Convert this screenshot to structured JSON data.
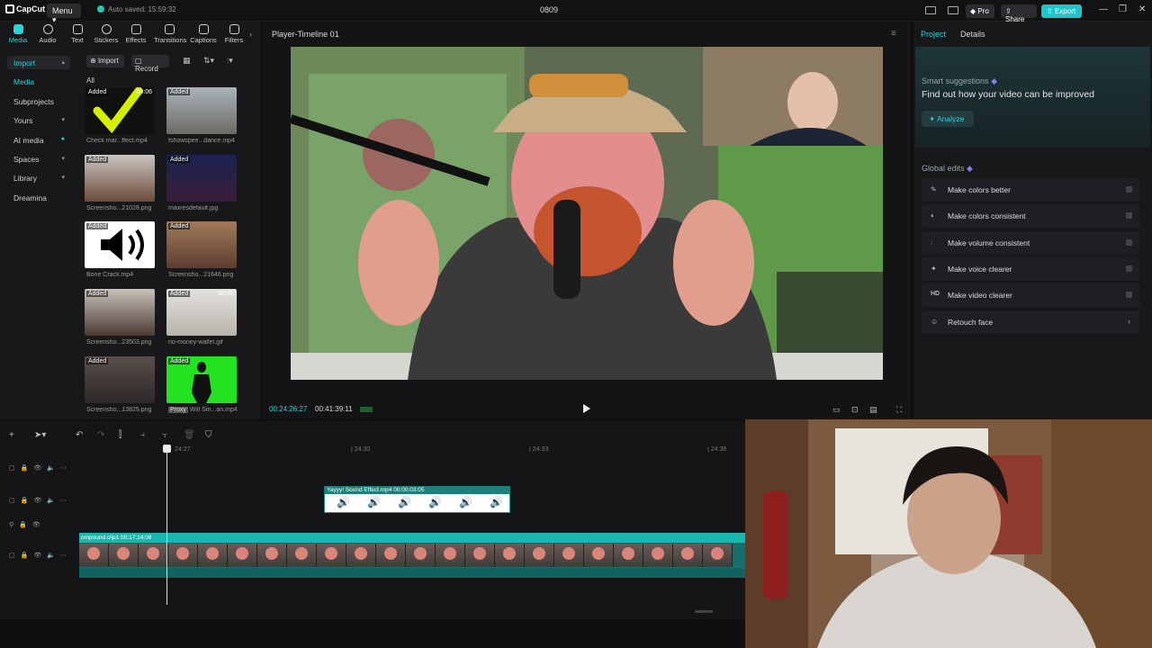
{
  "titlebar": {
    "app_name": "CapCut",
    "menu_label": "Menu",
    "autosave": "Auto saved: 15:59:32",
    "project_name": "0809",
    "pro_label": "Pro",
    "share_label": "Share",
    "export_label": "Export"
  },
  "toolbar": [
    "Media",
    "Audio",
    "Text",
    "Stickers",
    "Effects",
    "Transitions",
    "Captions",
    "Filters"
  ],
  "nav": {
    "import": "Import",
    "media": "Media",
    "subprojects": "Subprojects",
    "yours": "Yours",
    "ai_media": "AI media",
    "spaces": "Spaces",
    "library": "Library",
    "dreamina": "Dreamina"
  },
  "media": {
    "import_btn": "Import",
    "record_btn": "Record",
    "all_label": "All",
    "added_tag": "Added",
    "items": [
      {
        "caption": "Check mar...ffect.mp4",
        "duration": "00:06"
      },
      {
        "caption": "fshowspee...dance.mp4",
        "duration": ""
      },
      {
        "caption": "Screensho...21028.png",
        "duration": ""
      },
      {
        "caption": "maxresdefault.jpg",
        "duration": ""
      },
      {
        "caption": "Bone Crack.mp4",
        "duration": ""
      },
      {
        "caption": "Screensho...21646.png",
        "duration": ""
      },
      {
        "caption": "Screensho...23503.png",
        "duration": ""
      },
      {
        "caption": "no-money-wallet.gif",
        "duration": "00:05"
      },
      {
        "caption": "Screensho...13825.png",
        "duration": ""
      },
      {
        "caption": "Will Sm...an.mp4",
        "duration": ""
      }
    ],
    "proxy_tag": "Proxy"
  },
  "player": {
    "title": "Player-Timeline 01",
    "timecode_current": "00:24:26:27",
    "timecode_total": "00:41:39:11"
  },
  "right": {
    "tab_project": "Project",
    "tab_details": "Details",
    "smart_title": "Smart suggestions",
    "smart_sub": "Find out how your video can be improved",
    "analyze": "Analyze",
    "global_title": "Global edits",
    "edits": [
      {
        "label": "Make colors better",
        "icon": "✎"
      },
      {
        "label": "Make colors consistent",
        "icon": "◐"
      },
      {
        "label": "Make volume consistent",
        "icon": "⫶"
      },
      {
        "label": "Make voice clearer",
        "icon": "✦"
      },
      {
        "label": "Make video clearer",
        "icon": "HD"
      },
      {
        "label": "Retouch face",
        "icon": "☺"
      }
    ]
  },
  "timeline": {
    "ruler": [
      "24:27",
      "24:30",
      "24:33",
      "24:36"
    ],
    "sfx_clip": "Yayyy! Sound Effect.mp4  00:00:03:05",
    "main_clip": "ompound clip1  00:17:14:08"
  },
  "colors": {
    "accent": "#29d3d8",
    "export": "#1fc6c9",
    "clip_teal": "#19b8ae"
  }
}
